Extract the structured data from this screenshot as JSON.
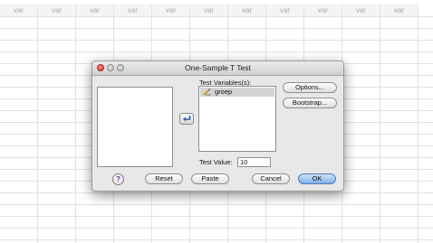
{
  "spreadsheet": {
    "column_header_label": "var",
    "columns": [
      "var",
      "var",
      "var",
      "var",
      "var",
      "var",
      "var",
      "var",
      "var",
      "var",
      "var"
    ]
  },
  "dialog": {
    "title": "One-Sample T Test",
    "test_variables_label": "Test Variables(s):",
    "target_variables": [
      {
        "name": "groep",
        "icon": "ruler-pencil-icon",
        "selected": true
      }
    ],
    "source_variables": [],
    "side_buttons": {
      "options": "Options...",
      "bootstrap": "Bootstrap..."
    },
    "test_value_label": "Test Value:",
    "test_value": "10",
    "help_label": "?",
    "buttons": {
      "reset": "Reset",
      "paste": "Paste",
      "cancel": "Cancel",
      "ok": "OK"
    },
    "colors": {
      "ok_accent": "#7fb0e6",
      "selection": "#d4d4d4",
      "close_button": "#d33333"
    }
  }
}
